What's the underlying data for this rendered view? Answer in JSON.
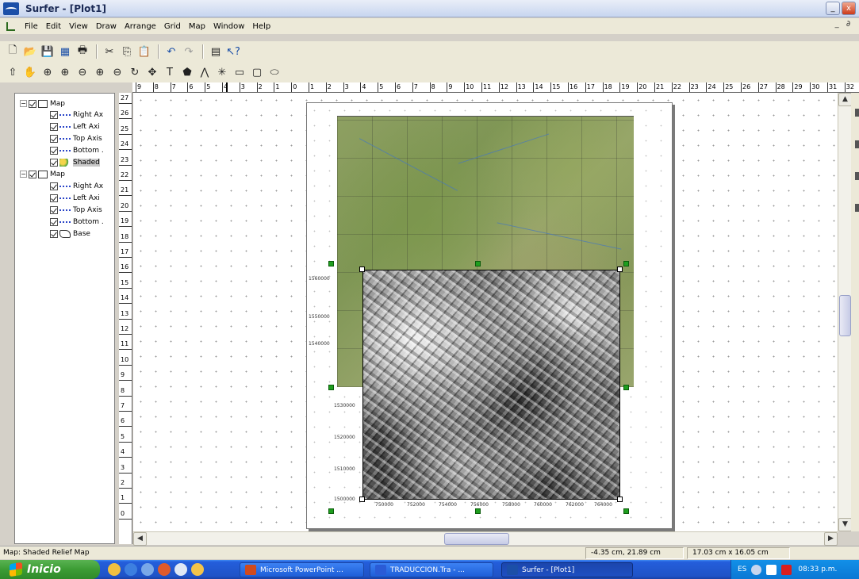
{
  "window": {
    "title": "Surfer - [Plot1]",
    "min_glyph": "_",
    "close_glyph": "x"
  },
  "menu": {
    "items": [
      "File",
      "Edit",
      "View",
      "Draw",
      "Arrange",
      "Grid",
      "Map",
      "Window",
      "Help"
    ],
    "right_glyphs": "_ ∂"
  },
  "object_manager": {
    "rows": [
      {
        "label": "Map",
        "type": "map",
        "expander": "−"
      },
      {
        "label": "Right Ax",
        "type": "axis"
      },
      {
        "label": "Left Axi",
        "type": "axis"
      },
      {
        "label": "Top Axis",
        "type": "axis"
      },
      {
        "label": "Bottom .",
        "type": "axis"
      },
      {
        "label": "Shaded",
        "type": "shaded",
        "selected": true
      },
      {
        "label": "Map",
        "type": "map",
        "expander": "−"
      },
      {
        "label": "Right Ax",
        "type": "axis"
      },
      {
        "label": "Left Axi",
        "type": "axis"
      },
      {
        "label": "Top Axis",
        "type": "axis"
      },
      {
        "label": "Bottom .",
        "type": "axis"
      },
      {
        "label": "Base",
        "type": "base"
      }
    ]
  },
  "rulers": {
    "horizontal": [
      "9",
      "8",
      "7",
      "6",
      "5",
      "4",
      "3",
      "2",
      "1",
      "0",
      "1",
      "2",
      "3",
      "4",
      "5",
      "6",
      "7",
      "8",
      "9",
      "10",
      "11",
      "12",
      "13",
      "14",
      "15",
      "16",
      "17",
      "18",
      "19",
      "20",
      "21",
      "22",
      "23",
      "24",
      "25",
      "26",
      "27",
      "28",
      "29",
      "30",
      "31",
      "32"
    ],
    "vertical": [
      "27",
      "26",
      "25",
      "24",
      "23",
      "22",
      "21",
      "20",
      "19",
      "18",
      "17",
      "16",
      "15",
      "14",
      "13",
      "12",
      "11",
      "10",
      "9",
      "8",
      "7",
      "6",
      "5",
      "4",
      "3",
      "2",
      "1",
      "0"
    ]
  },
  "map": {
    "relief_y_ticks": [
      "1530000",
      "1520000",
      "1510000",
      "1500000"
    ],
    "relief_x_ticks": [
      "750000",
      "752000",
      "754000",
      "756000",
      "758000",
      "760000",
      "762000",
      "764000"
    ],
    "topo_y_ticks": [
      "1560000",
      "1550000",
      "1540000"
    ]
  },
  "status": {
    "text": "Map: Shaded Relief Map",
    "coords": "-4.35 cm, 21.89 cm",
    "size": "17.03 cm x 16.05 cm"
  },
  "taskbar": {
    "start_label": "Inicio",
    "tasks": [
      {
        "label": "Microsoft PowerPoint ...",
        "color": "#d04a1e"
      },
      {
        "label": "TRADUCCION.Tra - ...",
        "color": "#2a5bd6"
      },
      {
        "label": "Surfer - [Plot1]",
        "color": "#1b4fa8",
        "active": true
      }
    ],
    "lang": "ES",
    "clock": "08:33 p.m."
  }
}
